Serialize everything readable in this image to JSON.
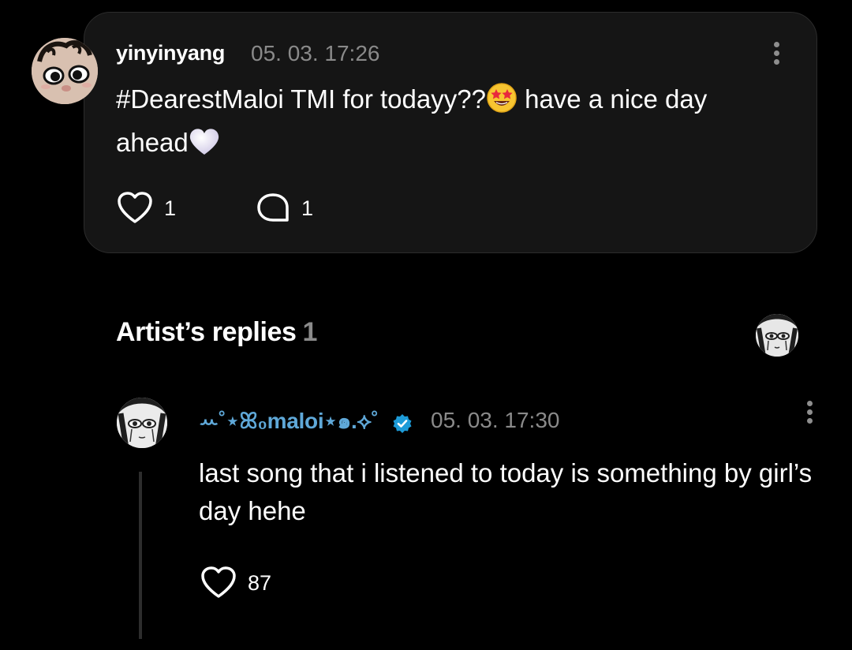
{
  "post": {
    "username": "yinyinyang",
    "timestamp": "05. 03. 17:26",
    "text_part1": "#DearestMaloi TMI for todayy??",
    "text_part2": " have a nice day ahead",
    "emoji_1": "star-struck",
    "emoji_2": "white-heart",
    "like_count": "1",
    "comment_count": "1"
  },
  "replies_section": {
    "title": "Artist’s replies",
    "count": "1"
  },
  "reply": {
    "username": "ꕀ˚⋆ꕤ₀maloi⋆๑.⟡˚",
    "verified": true,
    "timestamp": "05. 03. 17:30",
    "text": "last song that i listened to today is something by girl’s day hehe",
    "like_count": "87"
  },
  "colors": {
    "background": "#000000",
    "card": "#151515",
    "muted_text": "#8a8a8a",
    "artist_name": "#5fa8d8",
    "verified_badge": "#1d9bd8"
  }
}
